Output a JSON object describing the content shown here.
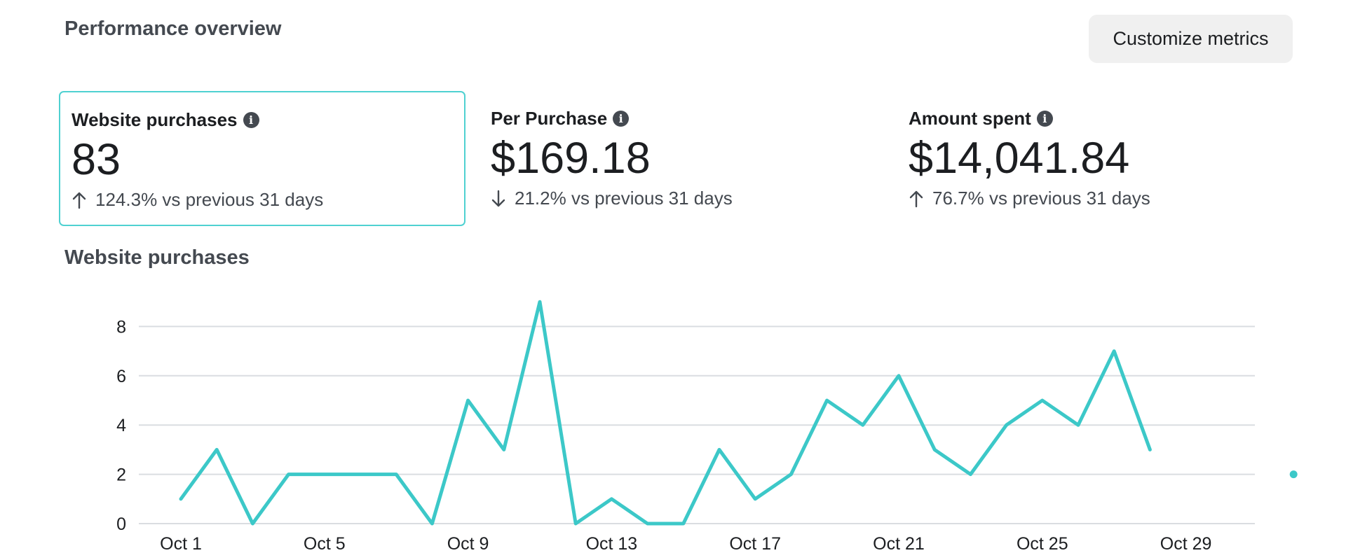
{
  "header": {
    "title": "Performance overview",
    "customize_label": "Customize metrics"
  },
  "metrics": [
    {
      "label": "Website purchases",
      "value": "83",
      "direction": "up",
      "change": "124.3% vs previous 31 days",
      "selected": true
    },
    {
      "label": "Per Purchase",
      "value": "$169.18",
      "direction": "down",
      "change": "21.2% vs previous 31 days",
      "selected": false
    },
    {
      "label": "Amount spent",
      "value": "$14,041.84",
      "direction": "up",
      "change": "76.7% vs previous 31 days",
      "selected": false
    }
  ],
  "chart_data": {
    "type": "line",
    "title": "Website purchases",
    "x_tick_labels": [
      "Oct 1",
      "Oct 5",
      "Oct 9",
      "Oct 13",
      "Oct 17",
      "Oct 21",
      "Oct 25",
      "Oct 29"
    ],
    "x_start_day": 1,
    "x_end_day": 32,
    "y_ticks": [
      0,
      2,
      4,
      6,
      8
    ],
    "ylim": [
      0,
      9
    ],
    "grid": true,
    "color": "#3cc8c8",
    "series": [
      {
        "days": [
          1,
          2,
          3,
          4,
          5,
          6,
          7,
          8,
          9,
          10,
          11,
          12,
          13,
          14,
          15,
          16,
          17,
          18,
          19,
          20,
          21,
          22,
          23,
          24,
          25,
          26,
          27,
          28
        ],
        "values": [
          1,
          3,
          0,
          2,
          2,
          2,
          2,
          0,
          5,
          3,
          9,
          0,
          1,
          0,
          0,
          3,
          1,
          2,
          5,
          4,
          6,
          3,
          2,
          4,
          5,
          4,
          7,
          3
        ]
      }
    ],
    "markers": [
      {
        "day": 32,
        "value": 2
      }
    ]
  }
}
